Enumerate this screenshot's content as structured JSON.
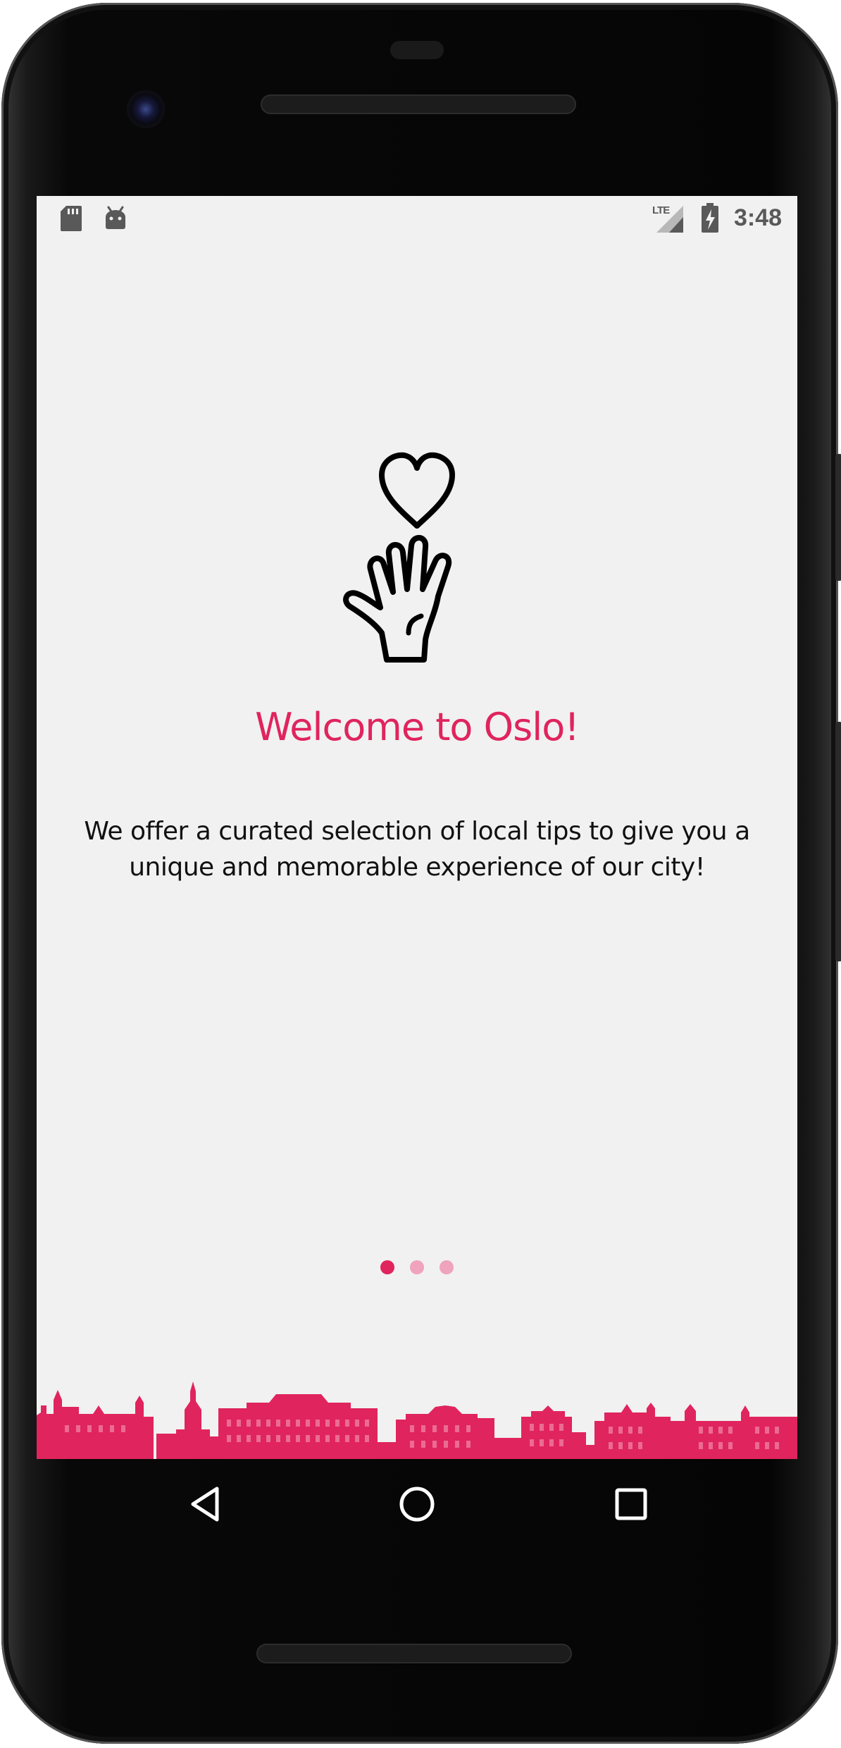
{
  "status_bar": {
    "time": "3:48",
    "network": "LTE",
    "icons": [
      "sd-card-icon",
      "android-debug-icon",
      "lte-signal-icon",
      "battery-charging-icon"
    ]
  },
  "onboarding": {
    "illustration": "heart-hand-icon",
    "title": "Welcome to Oslo!",
    "description": "We offer a curated selection of local tips to give you a unique and memorable experience of our city!",
    "pager": {
      "current": 1,
      "total": 3
    }
  },
  "navigation_bar": {
    "buttons": [
      "back-icon",
      "home-icon",
      "recents-icon"
    ]
  },
  "colors": {
    "accent": "#e0245e",
    "accent_inactive": "#efa3bd",
    "screen_background": "#f1f1f1",
    "status_icons": "#595959"
  }
}
